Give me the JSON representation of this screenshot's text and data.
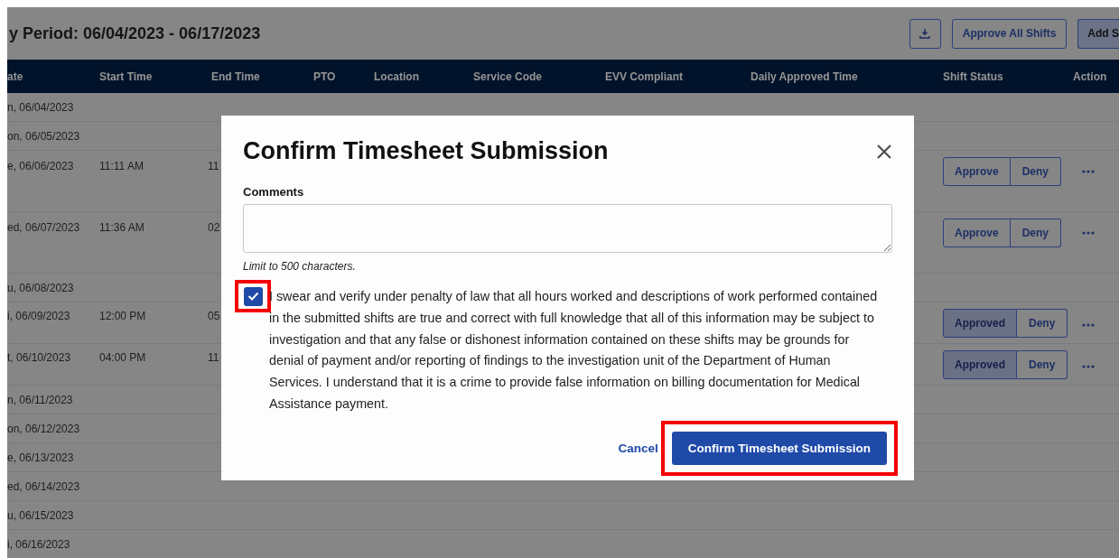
{
  "page": {
    "title": "y Period: 06/04/2023 - 06/17/2023",
    "buttons": [
      {
        "kind": "download"
      },
      {
        "kind": "text",
        "label": "Approve All Shifts"
      },
      {
        "kind": "text",
        "label": "Add S"
      }
    ]
  },
  "table": {
    "columns": [
      "ate",
      "Start Time",
      "End Time",
      "PTO",
      "Location",
      "Service Code",
      "EVV Compliant",
      "Daily Approved Time",
      "Shift Status",
      "Action"
    ],
    "rows": [
      {
        "date": "n, 06/04/2023"
      },
      {
        "date": "on, 06/05/2023"
      },
      {
        "date": "e, 06/06/2023",
        "start_time": "11:11 AM",
        "end_time": "11",
        "status": {
          "approve_label": "Approve",
          "approved": false,
          "deny_label": "Deny"
        }
      },
      {
        "date": "ed, 06/07/2023",
        "start_time": "11:36 AM",
        "end_time": "02",
        "status": {
          "approve_label": "Approve",
          "approved": false,
          "deny_label": "Deny"
        }
      },
      {
        "date": "u, 06/08/2023"
      },
      {
        "date": "i, 06/09/2023",
        "start_time": "12:00 PM",
        "end_time": "05",
        "status": {
          "approve_label": "Approved",
          "approved": true,
          "deny_label": "Deny"
        }
      },
      {
        "date": "t, 06/10/2023",
        "start_time": "04:00 PM",
        "end_time": "11",
        "status": {
          "approve_label": "Approved",
          "approved": true,
          "deny_label": "Deny"
        }
      },
      {
        "date": "n, 06/11/2023"
      },
      {
        "date": "on, 06/12/2023"
      },
      {
        "date": "e, 06/13/2023"
      },
      {
        "date": "ed, 06/14/2023"
      },
      {
        "date": "u, 06/15/2023"
      },
      {
        "date": "i, 06/16/2023"
      }
    ]
  },
  "dialog": {
    "title": "Confirm Timesheet Submission",
    "comments_label": "Comments",
    "comments_hint": "Limit to 500 characters.",
    "attestation": {
      "checked": true,
      "highlighted": true,
      "text": "I swear and verify under penalty of law that all hours worked and descriptions of work performed contained in the submitted shifts are true and correct with full knowledge that all of this information may be subject to investigation and that any false or dishonest information contained on these shifts may be grounds for denial of payment and/or reporting of findings to the investigation unit of the Department of Human Services. I understand that it is a crime to provide false information on billing documentation for Medical Assistance payment."
    },
    "cancel_label": "Cancel",
    "confirm": {
      "label": "Confirm Timesheet Submission",
      "highlighted": true
    }
  }
}
